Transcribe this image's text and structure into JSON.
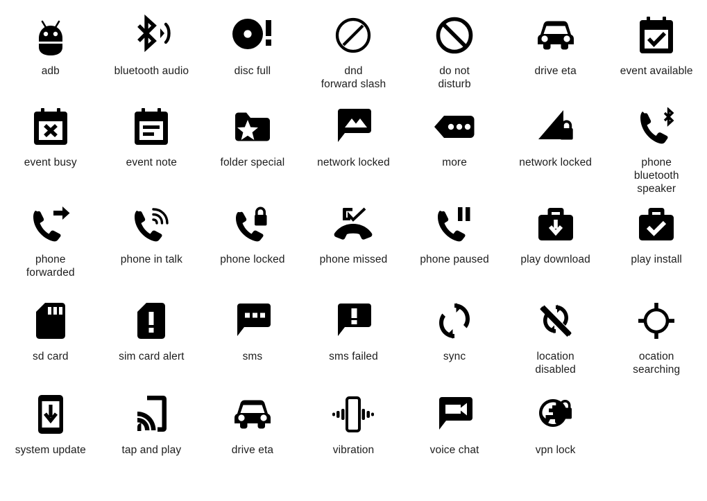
{
  "page": {
    "title": "Android status bar icon sheet",
    "background_color": "#ffffff",
    "icon_color": "#000000",
    "label_color": "#1d1d1d",
    "columns": 7,
    "rows": 5
  },
  "icons": [
    {
      "id": "adb",
      "label": "adb",
      "icon": "android-bug-icon"
    },
    {
      "id": "bluetooth-audio",
      "label": "bluetooth audio",
      "icon": "bluetooth-audio-icon"
    },
    {
      "id": "disc-full",
      "label": "disc full",
      "icon": "disc-full-icon"
    },
    {
      "id": "dnd-forward-slash",
      "label": "dnd\nforward slash",
      "icon": "dnd-forward-slash-icon"
    },
    {
      "id": "do-not-disturb",
      "label": "do not\ndisturb",
      "icon": "do-not-disturb-icon"
    },
    {
      "id": "drive-eta",
      "label": "drive eta",
      "icon": "car-icon"
    },
    {
      "id": "event-available",
      "label": "event available",
      "icon": "calendar-check-icon"
    },
    {
      "id": "event-busy",
      "label": "event busy",
      "icon": "calendar-cross-icon"
    },
    {
      "id": "event-note",
      "label": "event note",
      "icon": "calendar-note-icon"
    },
    {
      "id": "folder-special",
      "label": "folder special",
      "icon": "folder-star-icon"
    },
    {
      "id": "network-locked-msg",
      "label": "network locked",
      "icon": "message-image-icon"
    },
    {
      "id": "more",
      "label": "more",
      "icon": "more-tag-icon"
    },
    {
      "id": "network-locked",
      "label": "network locked",
      "icon": "signal-lock-icon"
    },
    {
      "id": "phone-bluetooth-speaker",
      "label": "phone\nbluetooth\nspeaker",
      "icon": "phone-bluetooth-icon"
    },
    {
      "id": "phone-forwarded",
      "label": "phone\nforwarded",
      "icon": "phone-forwarded-icon"
    },
    {
      "id": "phone-in-talk",
      "label": "phone in talk",
      "icon": "phone-in-talk-icon"
    },
    {
      "id": "phone-locked",
      "label": "phone locked",
      "icon": "phone-locked-icon"
    },
    {
      "id": "phone-missed",
      "label": "phone missed",
      "icon": "phone-missed-icon"
    },
    {
      "id": "phone-paused",
      "label": "phone paused",
      "icon": "phone-paused-icon"
    },
    {
      "id": "play-download",
      "label": "play download",
      "icon": "briefcase-download-icon"
    },
    {
      "id": "play-install",
      "label": "play install",
      "icon": "briefcase-check-icon"
    },
    {
      "id": "sd-card",
      "label": "sd card",
      "icon": "sd-card-icon"
    },
    {
      "id": "sim-card-alert",
      "label": "sim card alert",
      "icon": "sim-card-alert-icon"
    },
    {
      "id": "sms",
      "label": "sms",
      "icon": "sms-icon"
    },
    {
      "id": "sms-failed",
      "label": "sms failed",
      "icon": "sms-failed-icon"
    },
    {
      "id": "sync",
      "label": "sync",
      "icon": "sync-icon"
    },
    {
      "id": "location-disabled",
      "label": "location\ndisabled",
      "icon": "location-disabled-icon"
    },
    {
      "id": "location-searching",
      "label": "ocation\nsearching",
      "icon": "location-searching-icon"
    },
    {
      "id": "system-update",
      "label": "system update",
      "icon": "phone-download-icon"
    },
    {
      "id": "tap-and-play",
      "label": "tap and play",
      "icon": "tap-and-play-icon"
    },
    {
      "id": "drive-eta-2",
      "label": "drive eta",
      "icon": "car-icon"
    },
    {
      "id": "vibration",
      "label": "vibration",
      "icon": "vibration-icon"
    },
    {
      "id": "voice-chat",
      "label": "voice chat",
      "icon": "video-chat-icon"
    },
    {
      "id": "vpn-lock",
      "label": "vpn lock",
      "icon": "globe-lock-icon"
    }
  ]
}
